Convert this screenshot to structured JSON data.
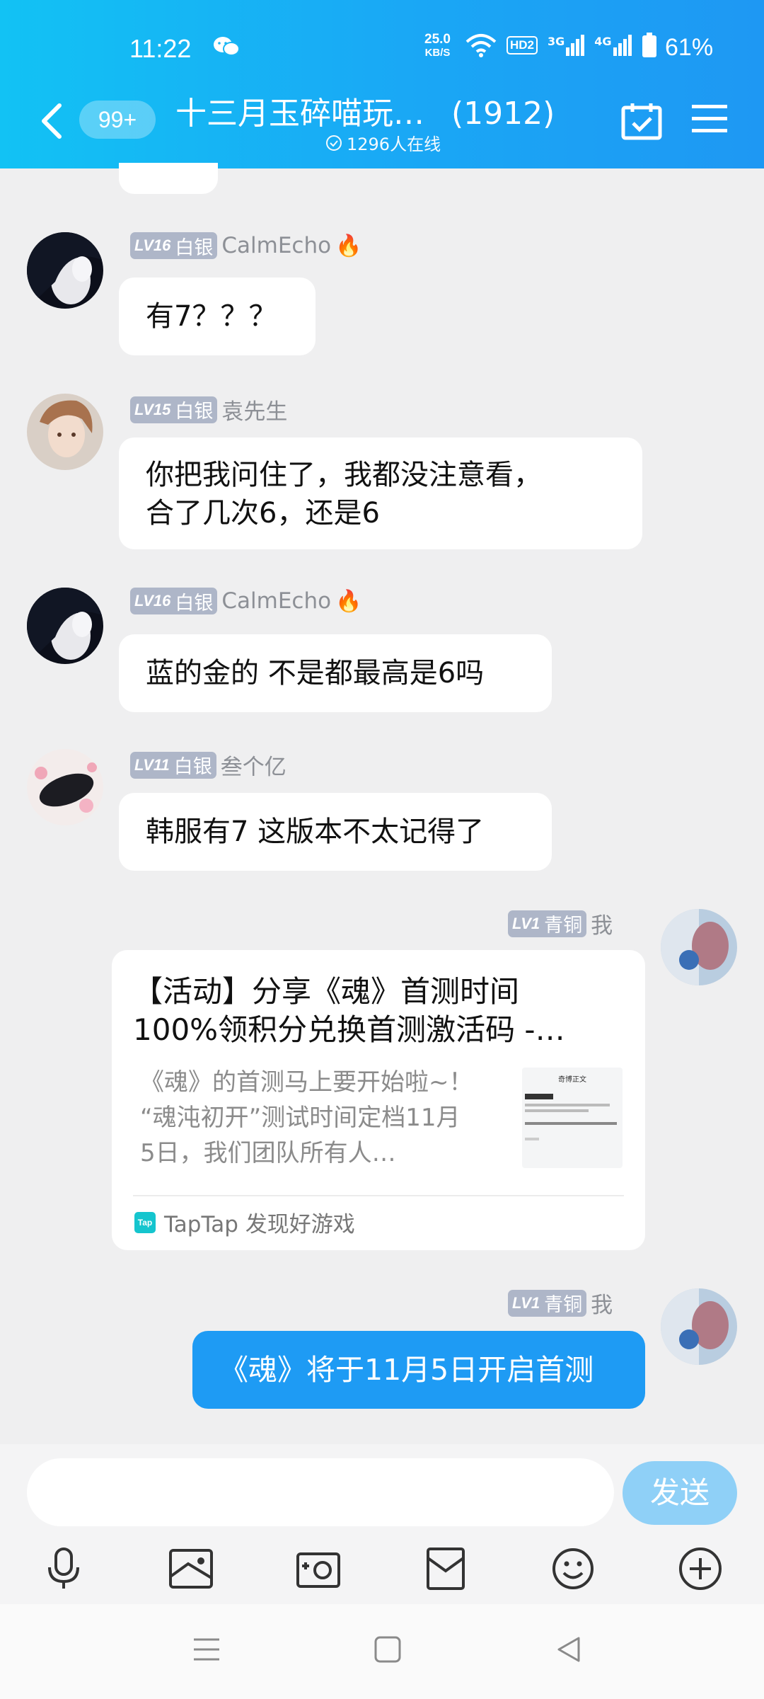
{
  "status_bar": {
    "time": "11:22",
    "net_speed_value": "25.0",
    "net_speed_unit": "KB/S",
    "hd_label": "HD2",
    "signal_1": "3G",
    "signal_2": "4G",
    "battery": "61%"
  },
  "header": {
    "unread_badge": "99+",
    "group_name": "十三月玉碎喵玩…",
    "member_count": "(1912)",
    "online_text": "1296人在线"
  },
  "messages": [
    {
      "level": "LV16",
      "rank": "白银",
      "name": "CalmEcho",
      "text": "有7？？？"
    },
    {
      "level": "LV15",
      "rank": "白银",
      "name": "袁先生",
      "line1": "你把我问住了，我都没注意看，",
      "line2": "合了几次6，还是6"
    },
    {
      "level": "LV16",
      "rank": "白银",
      "name": "CalmEcho",
      "text": "蓝的金的 不是都最高是6吗"
    },
    {
      "level": "LV11",
      "rank": "白银",
      "name": "叁个亿",
      "text": "韩服有7 这版本不太记得了"
    },
    {
      "level": "LV1",
      "rank": "青铜",
      "name": "我",
      "card": {
        "title_line1": "【活动】分享《魂》首测时间",
        "title_line2": "100%领积分兑换首测激活码 -…",
        "desc_line1": "《魂》的首测马上要开始啦~！",
        "desc_line2": "“魂沌初开”测试时间定档11月",
        "desc_line3": "5日，我们团队所有人…",
        "source": "TapTap 发现好游戏",
        "logo_text": "Tap",
        "thumb_text": "奇博正文"
      }
    },
    {
      "level": "LV1",
      "rank": "青铜",
      "name": "我",
      "text": "《魂》将于11月5日开启首测"
    }
  ],
  "input": {
    "placeholder": "",
    "send_label": "发送"
  },
  "toolbar_icons": [
    "microphone-icon",
    "image-icon",
    "camera-icon",
    "red-packet-icon",
    "emoji-icon",
    "plus-icon"
  ],
  "colors": {
    "header_start": "#12c2f4",
    "header_end": "#1e98f3",
    "my_bubble": "#1e9bf4",
    "send_button": "#8fd0f7",
    "level_badge": "#aeb6c8",
    "chat_background": "#efeff0"
  }
}
